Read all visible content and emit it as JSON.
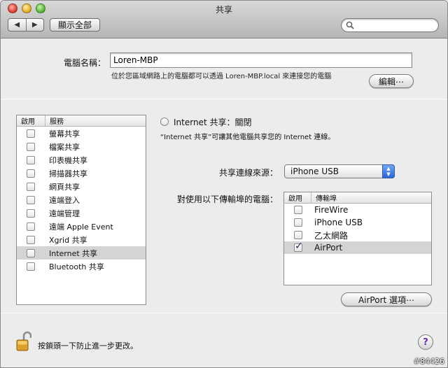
{
  "window": {
    "title": "共享"
  },
  "toolbar": {
    "back_glyph": "◀",
    "forward_glyph": "▶",
    "show_all_label": "顯示全部",
    "search_placeholder": ""
  },
  "computer": {
    "label": "電腦名稱：",
    "name_value": "Loren-MBP",
    "description": "位於您區域網路上的電腦都可以透過 Loren-MBP.local 來連接您的電腦",
    "edit_label": "編輯⋯"
  },
  "services": {
    "header_on": "啟用",
    "header_service": "服務",
    "items": [
      {
        "label": "螢幕共享",
        "checked": false,
        "selected": false
      },
      {
        "label": "檔案共享",
        "checked": false,
        "selected": false
      },
      {
        "label": "印表機共享",
        "checked": false,
        "selected": false
      },
      {
        "label": "掃描器共享",
        "checked": false,
        "selected": false
      },
      {
        "label": "網頁共享",
        "checked": false,
        "selected": false
      },
      {
        "label": "遠端登入",
        "checked": false,
        "selected": false
      },
      {
        "label": "遠端管理",
        "checked": false,
        "selected": false
      },
      {
        "label": "遠端 Apple Event",
        "checked": false,
        "selected": false
      },
      {
        "label": "Xgrid 共享",
        "checked": false,
        "selected": false
      },
      {
        "label": "Internet 共享",
        "checked": false,
        "selected": true
      },
      {
        "label": "Bluetooth 共享",
        "checked": false,
        "selected": false
      }
    ]
  },
  "internet_sharing": {
    "status_title": "Internet 共享：關閉",
    "description": "“Internet 共享”可讓其他電腦共享您的 Internet 連線。",
    "share_from_label": "共享連線來源：",
    "share_from_value": "iPhone USB",
    "to_computers_label": "對使用以下傳輸埠的電腦：",
    "ports_header_on": "啟用",
    "ports_header_port": "傳輸埠",
    "ports": [
      {
        "label": "FireWire",
        "checked": false,
        "selected": false
      },
      {
        "label": "iPhone USB",
        "checked": false,
        "selected": false
      },
      {
        "label": "乙太網路",
        "checked": false,
        "selected": false
      },
      {
        "label": "AirPort",
        "checked": true,
        "selected": true
      }
    ],
    "airport_options_label": "AirPort 選項⋯"
  },
  "footer": {
    "lock_text": "按鎖頭一下防止進一步更改。",
    "help_glyph": "?"
  },
  "watermark": "#84426"
}
